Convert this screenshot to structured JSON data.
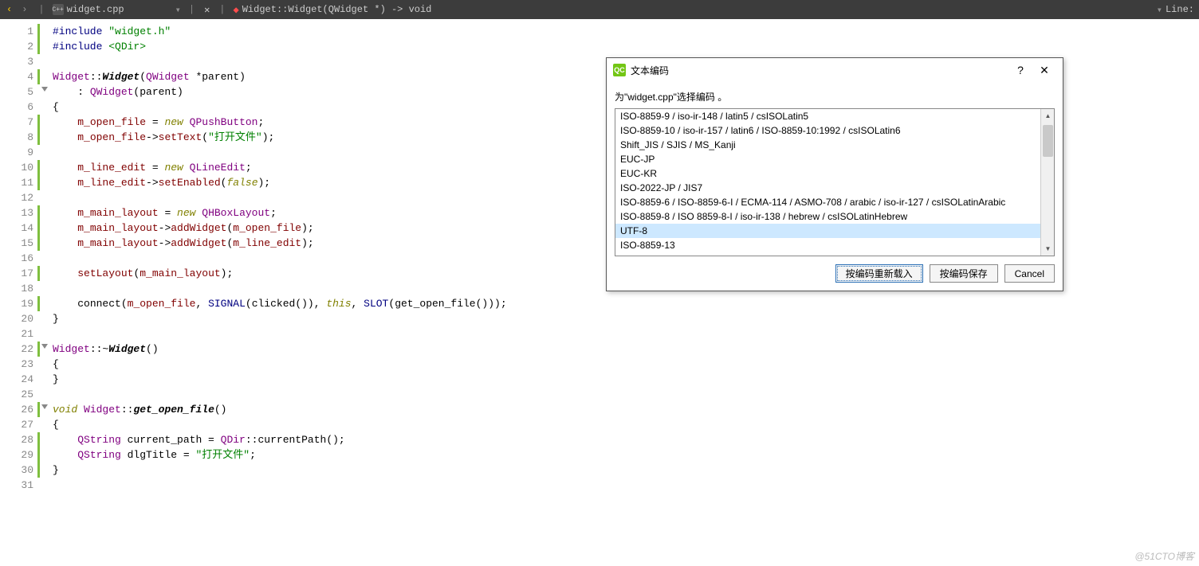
{
  "toolbar": {
    "file_name": "widget.cpp",
    "breadcrumb": "Widget::Widget(QWidget *) -> void",
    "line_label": "Line:",
    "file_badge": "C++"
  },
  "gutter": {
    "lines": [
      1,
      2,
      3,
      4,
      5,
      6,
      7,
      8,
      9,
      10,
      11,
      12,
      13,
      14,
      15,
      16,
      17,
      18,
      19,
      20,
      21,
      22,
      23,
      24,
      25,
      26,
      27,
      28,
      29,
      30,
      31
    ],
    "modified": [
      1,
      2,
      4,
      7,
      8,
      10,
      11,
      13,
      14,
      15,
      17,
      19,
      22,
      26,
      28,
      29,
      30
    ],
    "fold_at": [
      5,
      22,
      26
    ]
  },
  "code": {
    "l1": {
      "a": "#include ",
      "b": "\"widget.h\""
    },
    "l2": {
      "a": "#include ",
      "b": "<QDir>"
    },
    "l4": {
      "a": "Widget",
      "b": "::",
      "c": "Widget",
      "d": "(",
      "e": "QWidget",
      "f": " *parent)"
    },
    "l5": {
      "a": "    : ",
      "b": "QWidget",
      "c": "(parent)"
    },
    "l6": "{",
    "l7": {
      "a": "    ",
      "b": "m_open_file",
      "c": " = ",
      "d": "new",
      "e": " ",
      "f": "QPushButton",
      "g": ";"
    },
    "l8": {
      "a": "    ",
      "b": "m_open_file",
      "c": "->",
      "d": "setText",
      "e": "(",
      "f": "\"打开文件\"",
      "g": ");"
    },
    "l10": {
      "a": "    ",
      "b": "m_line_edit",
      "c": " = ",
      "d": "new",
      "e": " ",
      "f": "QLineEdit",
      "g": ";"
    },
    "l11": {
      "a": "    ",
      "b": "m_line_edit",
      "c": "->",
      "d": "setEnabled",
      "e": "(",
      "f": "false",
      "g": ");"
    },
    "l13": {
      "a": "    ",
      "b": "m_main_layout",
      "c": " = ",
      "d": "new",
      "e": " ",
      "f": "QHBoxLayout",
      "g": ";"
    },
    "l14": {
      "a": "    ",
      "b": "m_main_layout",
      "c": "->",
      "d": "addWidget",
      "e": "(",
      "f": "m_open_file",
      "g": ");"
    },
    "l15": {
      "a": "    ",
      "b": "m_main_layout",
      "c": "->",
      "d": "addWidget",
      "e": "(",
      "f": "m_line_edit",
      "g": ");"
    },
    "l17": {
      "a": "    ",
      "b": "setLayout",
      "c": "(",
      "d": "m_main_layout",
      "e": ");"
    },
    "l19": {
      "a": "    ",
      "b": "connect",
      "c": "(",
      "d": "m_open_file",
      "e": ", ",
      "f": "SIGNAL",
      "g": "(",
      "h": "clicked",
      "i": "()), ",
      "j": "this",
      "k": ", ",
      "l": "SLOT",
      "m": "(",
      "n": "get_open_file",
      "o": "()));"
    },
    "l20": "}",
    "l22": {
      "a": "Widget",
      "b": "::~",
      "c": "Widget",
      "d": "()"
    },
    "l23": "{",
    "l24": "}",
    "l26": {
      "a": "void",
      "b": " ",
      "c": "Widget",
      "d": "::",
      "e": "get_open_file",
      "f": "()"
    },
    "l27": "{",
    "l28": {
      "a": "    ",
      "b": "QString",
      "c": " current_path = ",
      "d": "QDir",
      "e": "::",
      "f": "currentPath",
      "g": "();"
    },
    "l29": {
      "a": "    ",
      "b": "QString",
      "c": " dlgTitle = ",
      "d": "\"打开文件\"",
      "e": ";"
    },
    "l30": "}"
  },
  "dialog": {
    "badge": "QC",
    "title": "文本编码",
    "message": "为\"widget.cpp\"选择编码 。",
    "encodings": [
      "ISO-8859-9 / iso-ir-148 / latin5 / csISOLatin5",
      "ISO-8859-10 / iso-ir-157 / latin6 / ISO-8859-10:1992 / csISOLatin6",
      "Shift_JIS / SJIS / MS_Kanji",
      "EUC-JP",
      "EUC-KR",
      "ISO-2022-JP / JIS7",
      "ISO-8859-6 / ISO-8859-6-I / ECMA-114 / ASMO-708 / arabic / iso-ir-127 / csISOLatinArabic",
      "ISO-8859-8 / ISO 8859-8-I / iso-ir-138 / hebrew / csISOLatinHebrew",
      "UTF-8",
      "ISO-8859-13"
    ],
    "selected_index": 8,
    "btn_reload": "按编码重新载入",
    "btn_save": "按编码保存",
    "btn_cancel": "Cancel"
  },
  "watermark": "@51CTO博客"
}
